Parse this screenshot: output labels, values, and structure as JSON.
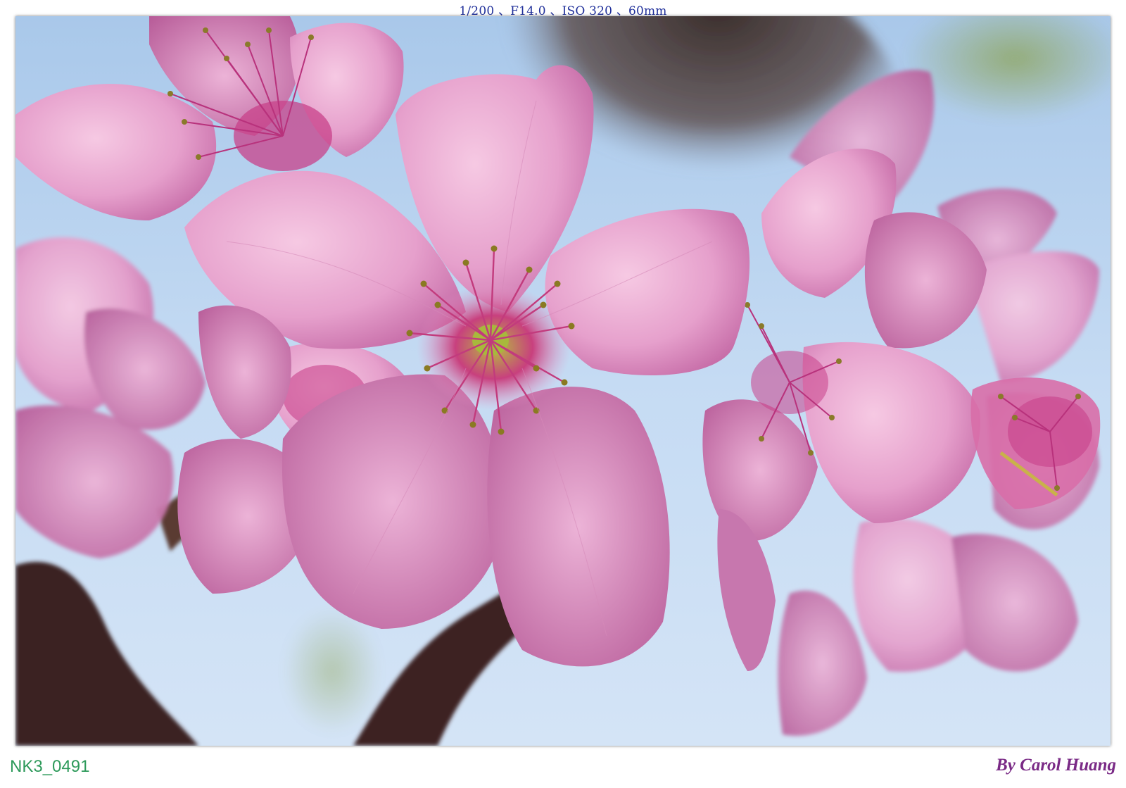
{
  "header": {
    "exif_text": "1/200 、F14.0 、ISO 320 、60mm"
  },
  "footer": {
    "file_id": "NK3_0491",
    "credit": "By Carol Huang"
  },
  "colors": {
    "exif_text": "#1f2f9a",
    "file_id": "#2e9a5b",
    "credit": "#7a2a86",
    "sky": "#b7d3ef",
    "petal": "#e9a6d0",
    "petal_dark": "#c9609f",
    "branch": "#3a2222"
  },
  "photo": {
    "subject": "pink cherry blossoms against blue sky"
  }
}
